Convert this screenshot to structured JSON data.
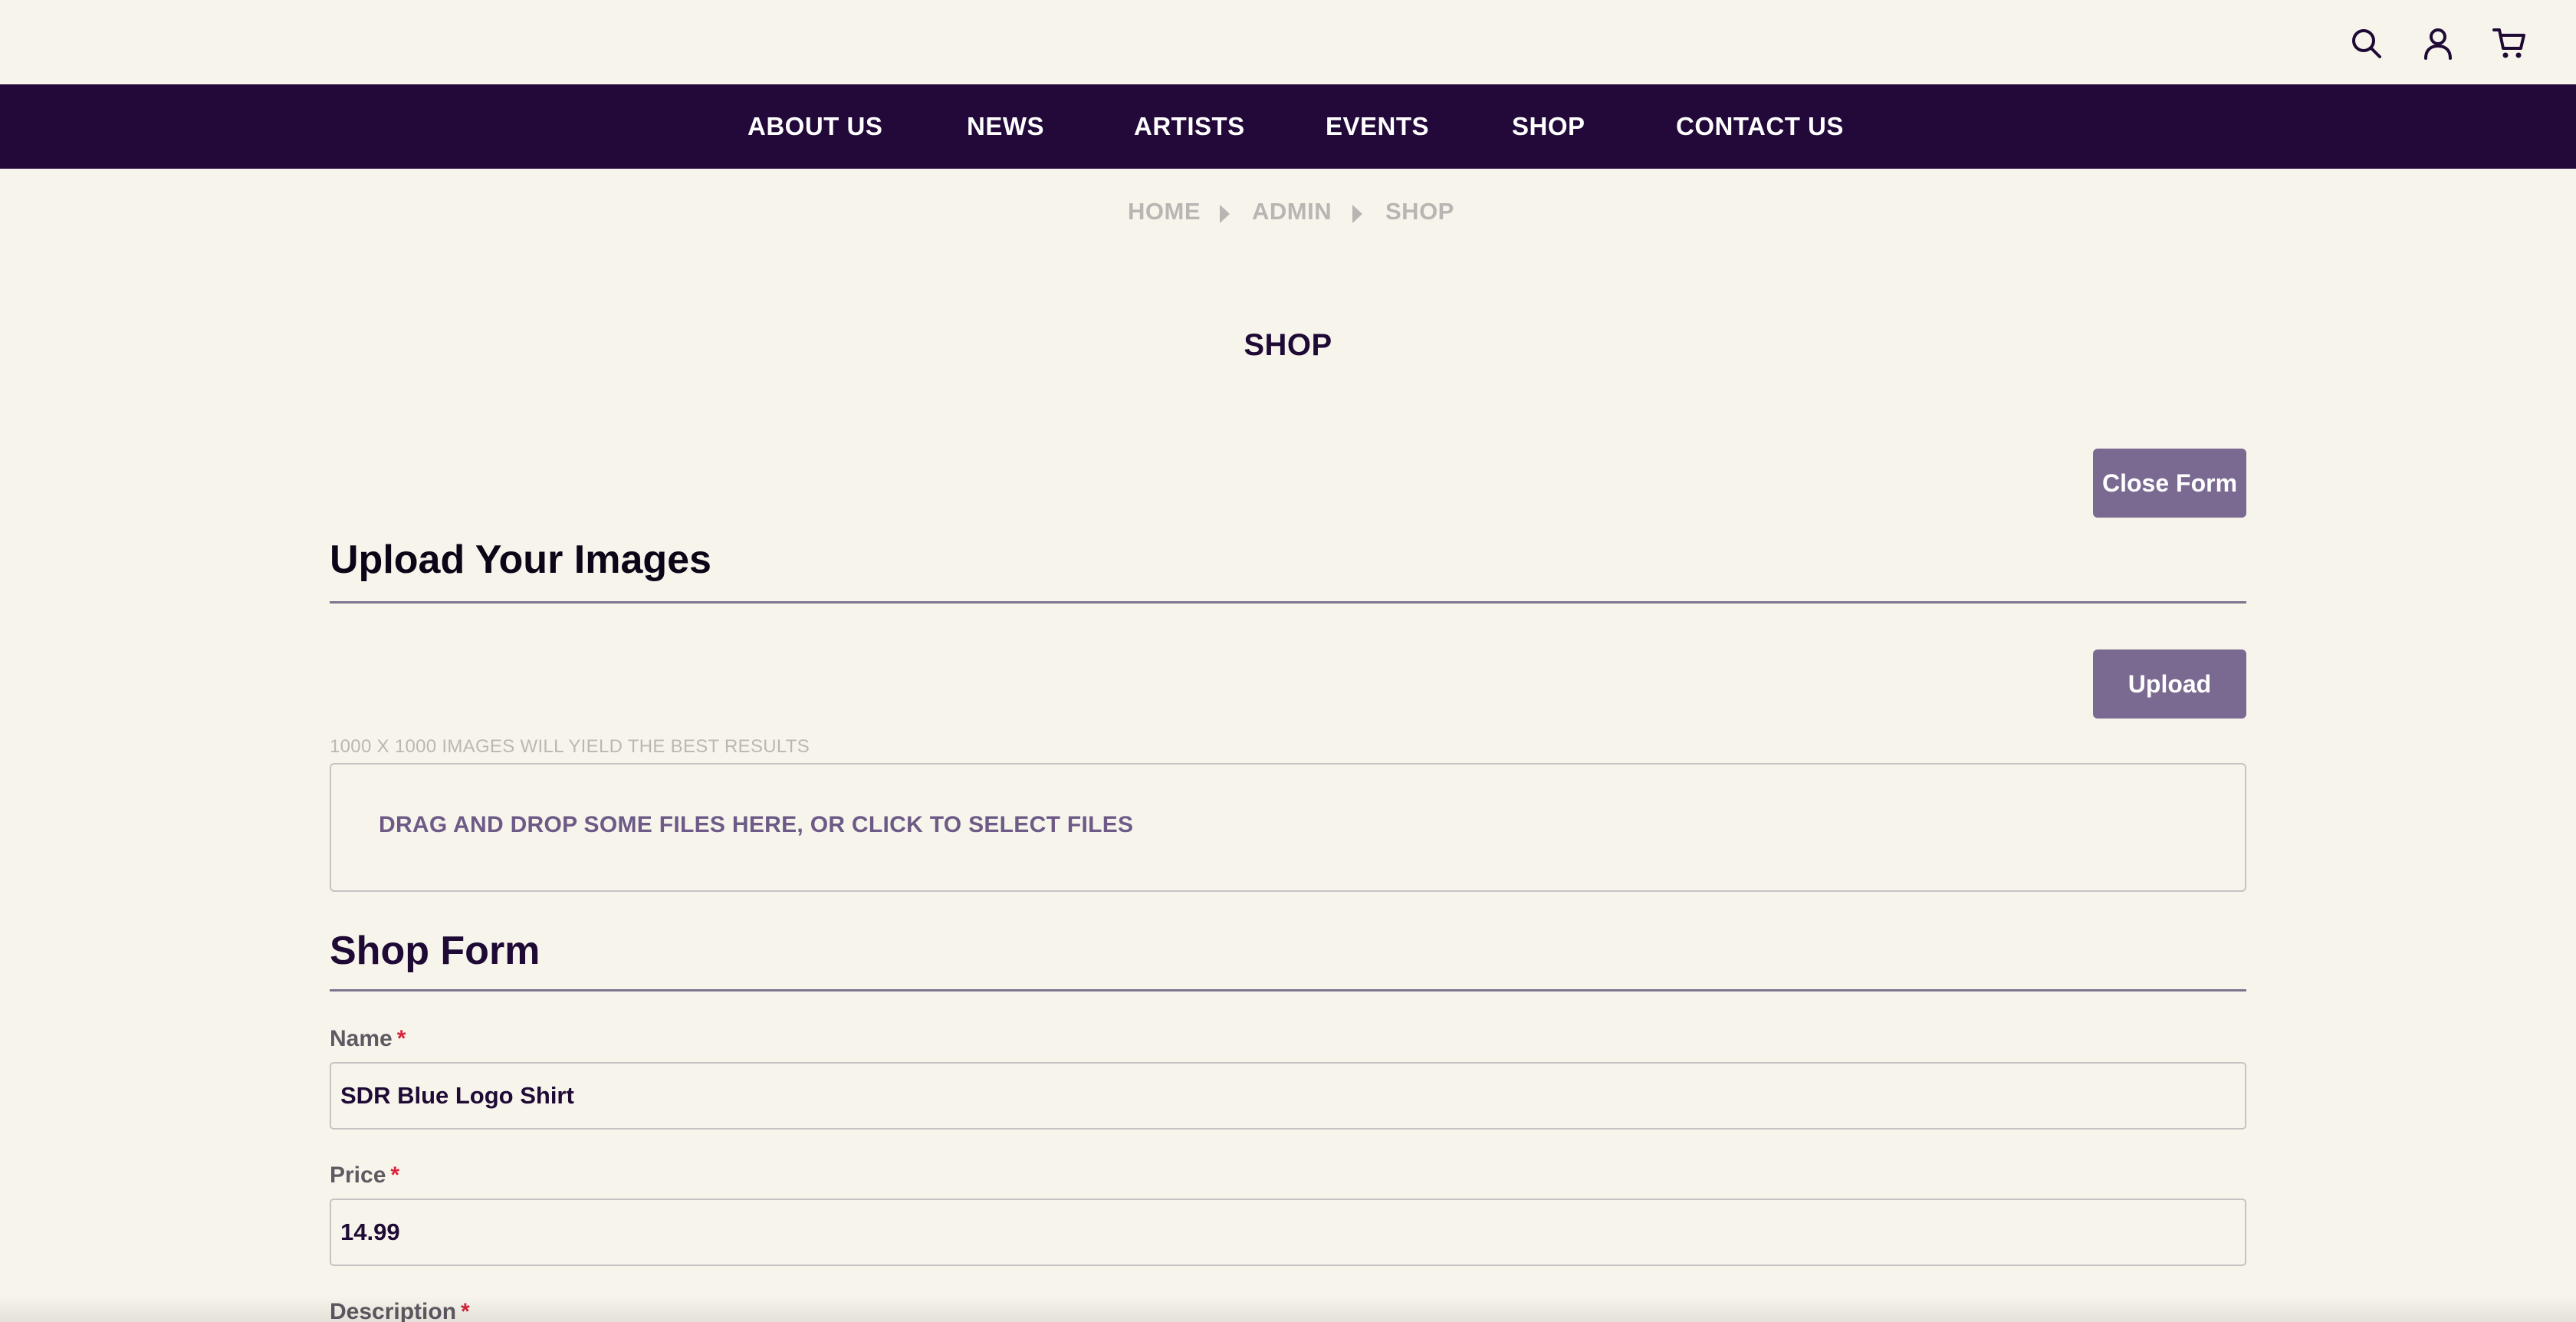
{
  "header": {
    "icons": [
      "search-icon",
      "account-icon",
      "cart-icon"
    ]
  },
  "nav": {
    "items": [
      {
        "label": "ABOUT US"
      },
      {
        "label": "NEWS"
      },
      {
        "label": "ARTISTS"
      },
      {
        "label": "EVENTS"
      },
      {
        "label": "SHOP"
      },
      {
        "label": "CONTACT US"
      }
    ]
  },
  "breadcrumb": {
    "items": [
      {
        "label": "HOME"
      },
      {
        "label": "ADMIN"
      },
      {
        "label": "SHOP"
      }
    ]
  },
  "page": {
    "title": "SHOP",
    "close_form_label": "Close Form"
  },
  "upload": {
    "heading": "Upload Your Images",
    "upload_label": "Upload",
    "hint": "1000 X 1000 IMAGES WILL YIELD THE BEST RESULTS",
    "dropzone_text": "DRAG AND DROP SOME FILES HERE, OR CLICK TO SELECT FILES"
  },
  "form": {
    "heading": "Shop Form",
    "required_marker": "*",
    "fields": [
      {
        "label": "Name",
        "value": "SDR Blue Logo Shirt"
      },
      {
        "label": "Price",
        "value": "14.99"
      },
      {
        "label": "Description",
        "value": ""
      }
    ]
  },
  "colors": {
    "nav_bg": "#22093a",
    "page_bg": "#f7f4ec",
    "button_bg": "#7a6991",
    "required": "#d8233b"
  }
}
